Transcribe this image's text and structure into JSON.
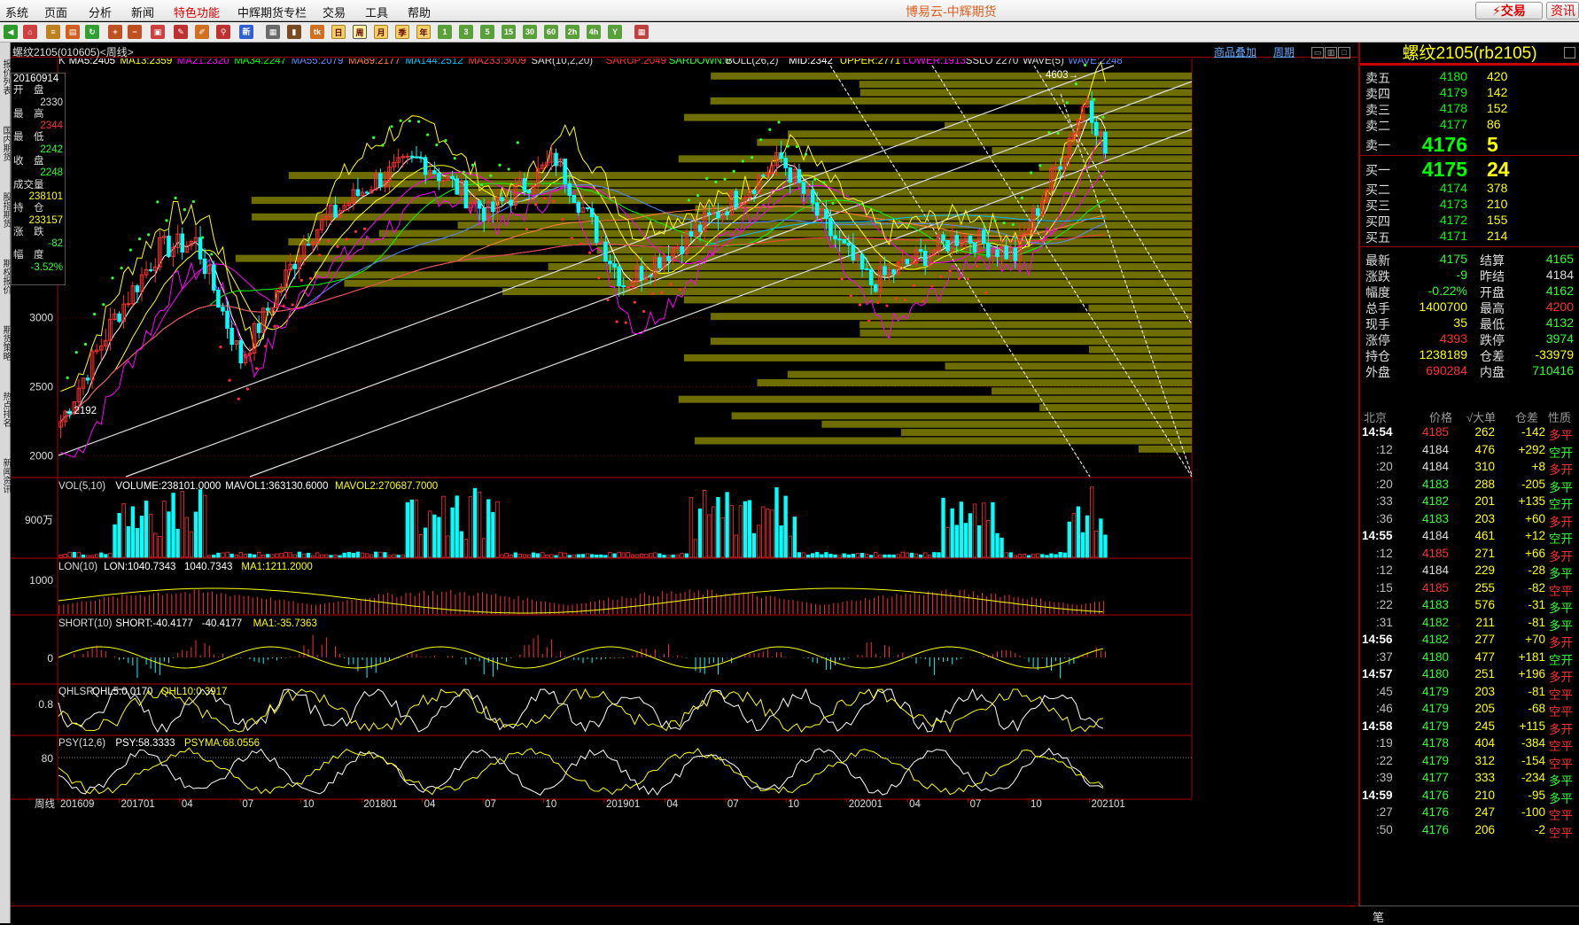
{
  "menu": {
    "items": [
      "系统",
      "页面",
      "分析",
      "新闻",
      "特色功能",
      "中辉期货专栏",
      "交易",
      "工具",
      "帮助"
    ],
    "highlight": "特色功能"
  },
  "app_title": "博易云-中辉期货",
  "trade_button": "交易",
  "more_button": "资讯",
  "toolbar": {
    "period_buttons": [
      "1",
      "3",
      "5",
      "15",
      "30",
      "60",
      "2h",
      "4h",
      "Y"
    ],
    "selected": "周",
    "calendar_buttons": [
      "日",
      "周",
      "月",
      "季",
      "年"
    ]
  },
  "left_tabs": [
    "报价列表",
    "国内期货",
    "股指期货",
    "期权报价",
    "期货策略",
    "热点排名",
    "新闻资讯"
  ],
  "section": {
    "title": "螺纹2105(010605)<周线>",
    "links": [
      "商品叠加",
      "周期"
    ]
  },
  "indicator_lines": {
    "main": [
      {
        "t": "K",
        "c": "#dddddd"
      },
      {
        "t": "MA5:2405",
        "c": "#ffffff"
      },
      {
        "t": "MA13:2359",
        "c": "#ffff00"
      },
      {
        "t": "MA21:2320",
        "c": "#ff00ff"
      },
      {
        "t": "MA34:2247",
        "c": "#00ff00"
      },
      {
        "t": "MA55:2079",
        "c": "#5a8cff"
      },
      {
        "t": "MA89:2177",
        "c": "#ff8040"
      },
      {
        "t": "MA144:2512",
        "c": "#00c0ff"
      },
      {
        "t": "MA233:3009",
        "c": "#ff4040"
      },
      {
        "t": "SAR(10,2,20)",
        "c": "#dddddd"
      },
      {
        "t": "SARUP:2049",
        "c": "#ff3030"
      },
      {
        "t": "SARDOWN:0",
        "c": "#30ff30"
      },
      {
        "t": "BOLL(26,2)",
        "c": "#dddddd"
      },
      {
        "t": "MID:2342",
        "c": "#ffffff"
      },
      {
        "t": "UPPER:2771",
        "c": "#ffff00"
      },
      {
        "t": "LOWER:1913",
        "c": "#ff00ff"
      },
      {
        "t": "SSLO 2270",
        "c": "#dddddd"
      },
      {
        "t": "WAVE(5)",
        "c": "#dddddd"
      },
      {
        "t": "WAVE:2248",
        "c": "#5a8cff"
      }
    ],
    "vol": [
      {
        "t": "VOL(5,10)",
        "c": "#dddddd"
      },
      {
        "t": "VOLUME:238101.0000",
        "c": "#ffffff"
      },
      {
        "t": "MAVOL1:363130.6000",
        "c": "#ffffff"
      },
      {
        "t": "MAVOL2:270687.7000",
        "c": "#ffff00"
      }
    ],
    "lon": [
      {
        "t": "LON(10)",
        "c": "#dddddd"
      },
      {
        "t": "LON:1040.7343",
        "c": "#ffffff"
      },
      {
        "t": "1040.7343",
        "c": "#ffffff"
      },
      {
        "t": "MA1:1211.2000",
        "c": "#ffff00"
      }
    ],
    "short": [
      {
        "t": "SHORT(10)",
        "c": "#dddddd"
      },
      {
        "t": "SHORT:-40.4177",
        "c": "#ffffff"
      },
      {
        "t": "-40.4177",
        "c": "#ffffff"
      },
      {
        "t": "MA1:-35.7363",
        "c": "#ffff00"
      }
    ],
    "qhlsr": [
      {
        "t": "QHLSR",
        "c": "#dddddd"
      },
      {
        "t": "QHL5:0.0170",
        "c": "#ffffff"
      },
      {
        "t": "QHL10:0.3917",
        "c": "#ffff00"
      }
    ],
    "psy": [
      {
        "t": "PSY(12,6)",
        "c": "#dddddd"
      },
      {
        "t": "PSY:58.3333",
        "c": "#ffffff"
      },
      {
        "t": "PSYMA:68.0556",
        "c": "#ffff00"
      }
    ]
  },
  "price_axis": {
    "labels": [
      "3000",
      "2500",
      "2000"
    ],
    "values": [
      3000,
      2500,
      2000
    ],
    "range": [
      1850,
      4800
    ]
  },
  "sub_axis": {
    "vol": "900万",
    "lon": "1000",
    "short": "0",
    "qhlsr": "0.8",
    "psy": "80"
  },
  "x_axis": {
    "prefix": "周线",
    "labels": [
      "201609",
      "201701",
      "04",
      "07",
      "10",
      "201801",
      "04",
      "07",
      "10",
      "201901",
      "04",
      "07",
      "10",
      "202001",
      "04",
      "07",
      "10",
      "202101"
    ]
  },
  "annotations": {
    "high": "4603",
    "low": "2192"
  },
  "infobox": [
    {
      "l": "20160914",
      "v": "",
      "c": "#ffffff"
    },
    {
      "l": "开　盘",
      "v": "2330",
      "c": "#dddddd"
    },
    {
      "l": "最　高",
      "v": "2344",
      "c": "#ff3030"
    },
    {
      "l": "最　低",
      "v": "2242",
      "c": "#30ff30"
    },
    {
      "l": "收　盘",
      "v": "2248",
      "c": "#30ff30"
    },
    {
      "l": "成交量",
      "v": "238101",
      "c": "#ffff00"
    },
    {
      "l": "持　仓",
      "v": "233157",
      "c": "#ffff00"
    },
    {
      "l": "涨　跌",
      "v": "-82",
      "c": "#30ff30"
    },
    {
      "l": "幅　度",
      "v": "-3.52%",
      "c": "#30ff30"
    }
  ],
  "quote": {
    "title": "螺纹2105(rb2105)",
    "sell": [
      {
        "l": "卖五",
        "p": "4180",
        "v": "420"
      },
      {
        "l": "卖四",
        "p": "4179",
        "v": "142"
      },
      {
        "l": "卖三",
        "p": "4178",
        "v": "152"
      },
      {
        "l": "卖二",
        "p": "4177",
        "v": "86"
      },
      {
        "l": "卖一",
        "p": "4176",
        "v": "5"
      }
    ],
    "buy": [
      {
        "l": "买一",
        "p": "4175",
        "v": "24"
      },
      {
        "l": "买二",
        "p": "4174",
        "v": "378"
      },
      {
        "l": "买三",
        "p": "4173",
        "v": "210"
      },
      {
        "l": "买四",
        "p": "4172",
        "v": "155"
      },
      {
        "l": "买五",
        "p": "4171",
        "v": "214"
      }
    ],
    "stats": [
      {
        "l1": "最新",
        "v1": "4175",
        "c1": "#30ff30",
        "l2": "结算",
        "v2": "4165",
        "c2": "#30ff30"
      },
      {
        "l1": "涨跌",
        "v1": "-9",
        "c1": "#30ff30",
        "l2": "昨结",
        "v2": "4184",
        "c2": "#dddddd"
      },
      {
        "l1": "幅度",
        "v1": "-0.22%",
        "c1": "#30ff30",
        "l2": "开盘",
        "v2": "4162",
        "c2": "#30ff30"
      },
      {
        "l1": "总手",
        "v1": "1400700",
        "c1": "#ffff00",
        "l2": "最高",
        "v2": "4200",
        "c2": "#ff3030"
      },
      {
        "l1": "现手",
        "v1": "35",
        "c1": "#ffff00",
        "l2": "最低",
        "v2": "4132",
        "c2": "#30ff30"
      },
      {
        "l1": "涨停",
        "v1": "4393",
        "c1": "#ff3030",
        "l2": "跌停",
        "v2": "3974",
        "c2": "#30ff30"
      },
      {
        "l1": "持仓",
        "v1": "1238189",
        "c1": "#ffff00",
        "l2": "仓差",
        "v2": "-33979",
        "c2": "#ffff00"
      },
      {
        "l1": "外盘",
        "v1": "690284",
        "c1": "#ff3030",
        "l2": "内盘",
        "v2": "710416",
        "c2": "#30ff30"
      }
    ],
    "tick_header": [
      "北京",
      "价格",
      "√大单",
      "仓差",
      "性质"
    ],
    "ticks": [
      {
        "t": "14:54",
        "p": "4185",
        "v": "262",
        "d": "-142",
        "n": "多平",
        "c": "#ff3030"
      },
      {
        "t": ":12",
        "p": "4184",
        "v": "476",
        "d": "+292",
        "n": "空开",
        "c": "#30ff30"
      },
      {
        "t": ":20",
        "p": "4184",
        "v": "310",
        "d": "+8",
        "n": "多开",
        "c": "#ff3030"
      },
      {
        "t": ":20",
        "p": "4183",
        "v": "288",
        "d": "-205",
        "n": "多平",
        "c": "#30ff30"
      },
      {
        "t": ":33",
        "p": "4182",
        "v": "201",
        "d": "+135",
        "n": "空开",
        "c": "#30ff30"
      },
      {
        "t": ":36",
        "p": "4183",
        "v": "203",
        "d": "+60",
        "n": "多开",
        "c": "#ff3030"
      },
      {
        "t": "14:55",
        "p": "4184",
        "v": "461",
        "d": "+12",
        "n": "空开",
        "c": "#30ff30"
      },
      {
        "t": ":12",
        "p": "4185",
        "v": "271",
        "d": "+66",
        "n": "多开",
        "c": "#ff3030"
      },
      {
        "t": ":12",
        "p": "4184",
        "v": "229",
        "d": "-28",
        "n": "多平",
        "c": "#30ff30"
      },
      {
        "t": ":15",
        "p": "4185",
        "v": "255",
        "d": "-82",
        "n": "空平",
        "c": "#ff3030"
      },
      {
        "t": ":22",
        "p": "4183",
        "v": "576",
        "d": "-31",
        "n": "多平",
        "c": "#30ff30"
      },
      {
        "t": ":31",
        "p": "4182",
        "v": "211",
        "d": "-81",
        "n": "多平",
        "c": "#30ff30"
      },
      {
        "t": "14:56",
        "p": "4182",
        "v": "277",
        "d": "+70",
        "n": "多开",
        "c": "#ff3030"
      },
      {
        "t": ":37",
        "p": "4180",
        "v": "477",
        "d": "+181",
        "n": "空开",
        "c": "#30ff30"
      },
      {
        "t": "14:57",
        "p": "4180",
        "v": "251",
        "d": "+196",
        "n": "多开",
        "c": "#ff3030"
      },
      {
        "t": ":45",
        "p": "4179",
        "v": "203",
        "d": "-81",
        "n": "空平",
        "c": "#ff3030"
      },
      {
        "t": ":46",
        "p": "4179",
        "v": "205",
        "d": "-68",
        "n": "空平",
        "c": "#ff3030"
      },
      {
        "t": "14:58",
        "p": "4179",
        "v": "245",
        "d": "+115",
        "n": "多开",
        "c": "#ff3030"
      },
      {
        "t": ":19",
        "p": "4178",
        "v": "404",
        "d": "-384",
        "n": "空平",
        "c": "#ff3030"
      },
      {
        "t": ":22",
        "p": "4179",
        "v": "312",
        "d": "-154",
        "n": "空平",
        "c": "#ff3030"
      },
      {
        "t": ":39",
        "p": "4177",
        "v": "333",
        "d": "-234",
        "n": "多平",
        "c": "#30ff30"
      },
      {
        "t": "14:59",
        "p": "4176",
        "v": "210",
        "d": "-95",
        "n": "多平",
        "c": "#30ff30"
      },
      {
        "t": ":27",
        "p": "4176",
        "v": "247",
        "d": "-100",
        "n": "空平",
        "c": "#ff3030"
      },
      {
        "t": ":50",
        "p": "4176",
        "v": "206",
        "d": "-2",
        "n": "空平",
        "c": "#ff3030"
      }
    ],
    "bottom_tab": "笔"
  },
  "colors": {
    "up": "#ff3030",
    "down": "#00ffff",
    "bg": "#000000",
    "grid": "#8b0000",
    "profile": "#808000"
  }
}
